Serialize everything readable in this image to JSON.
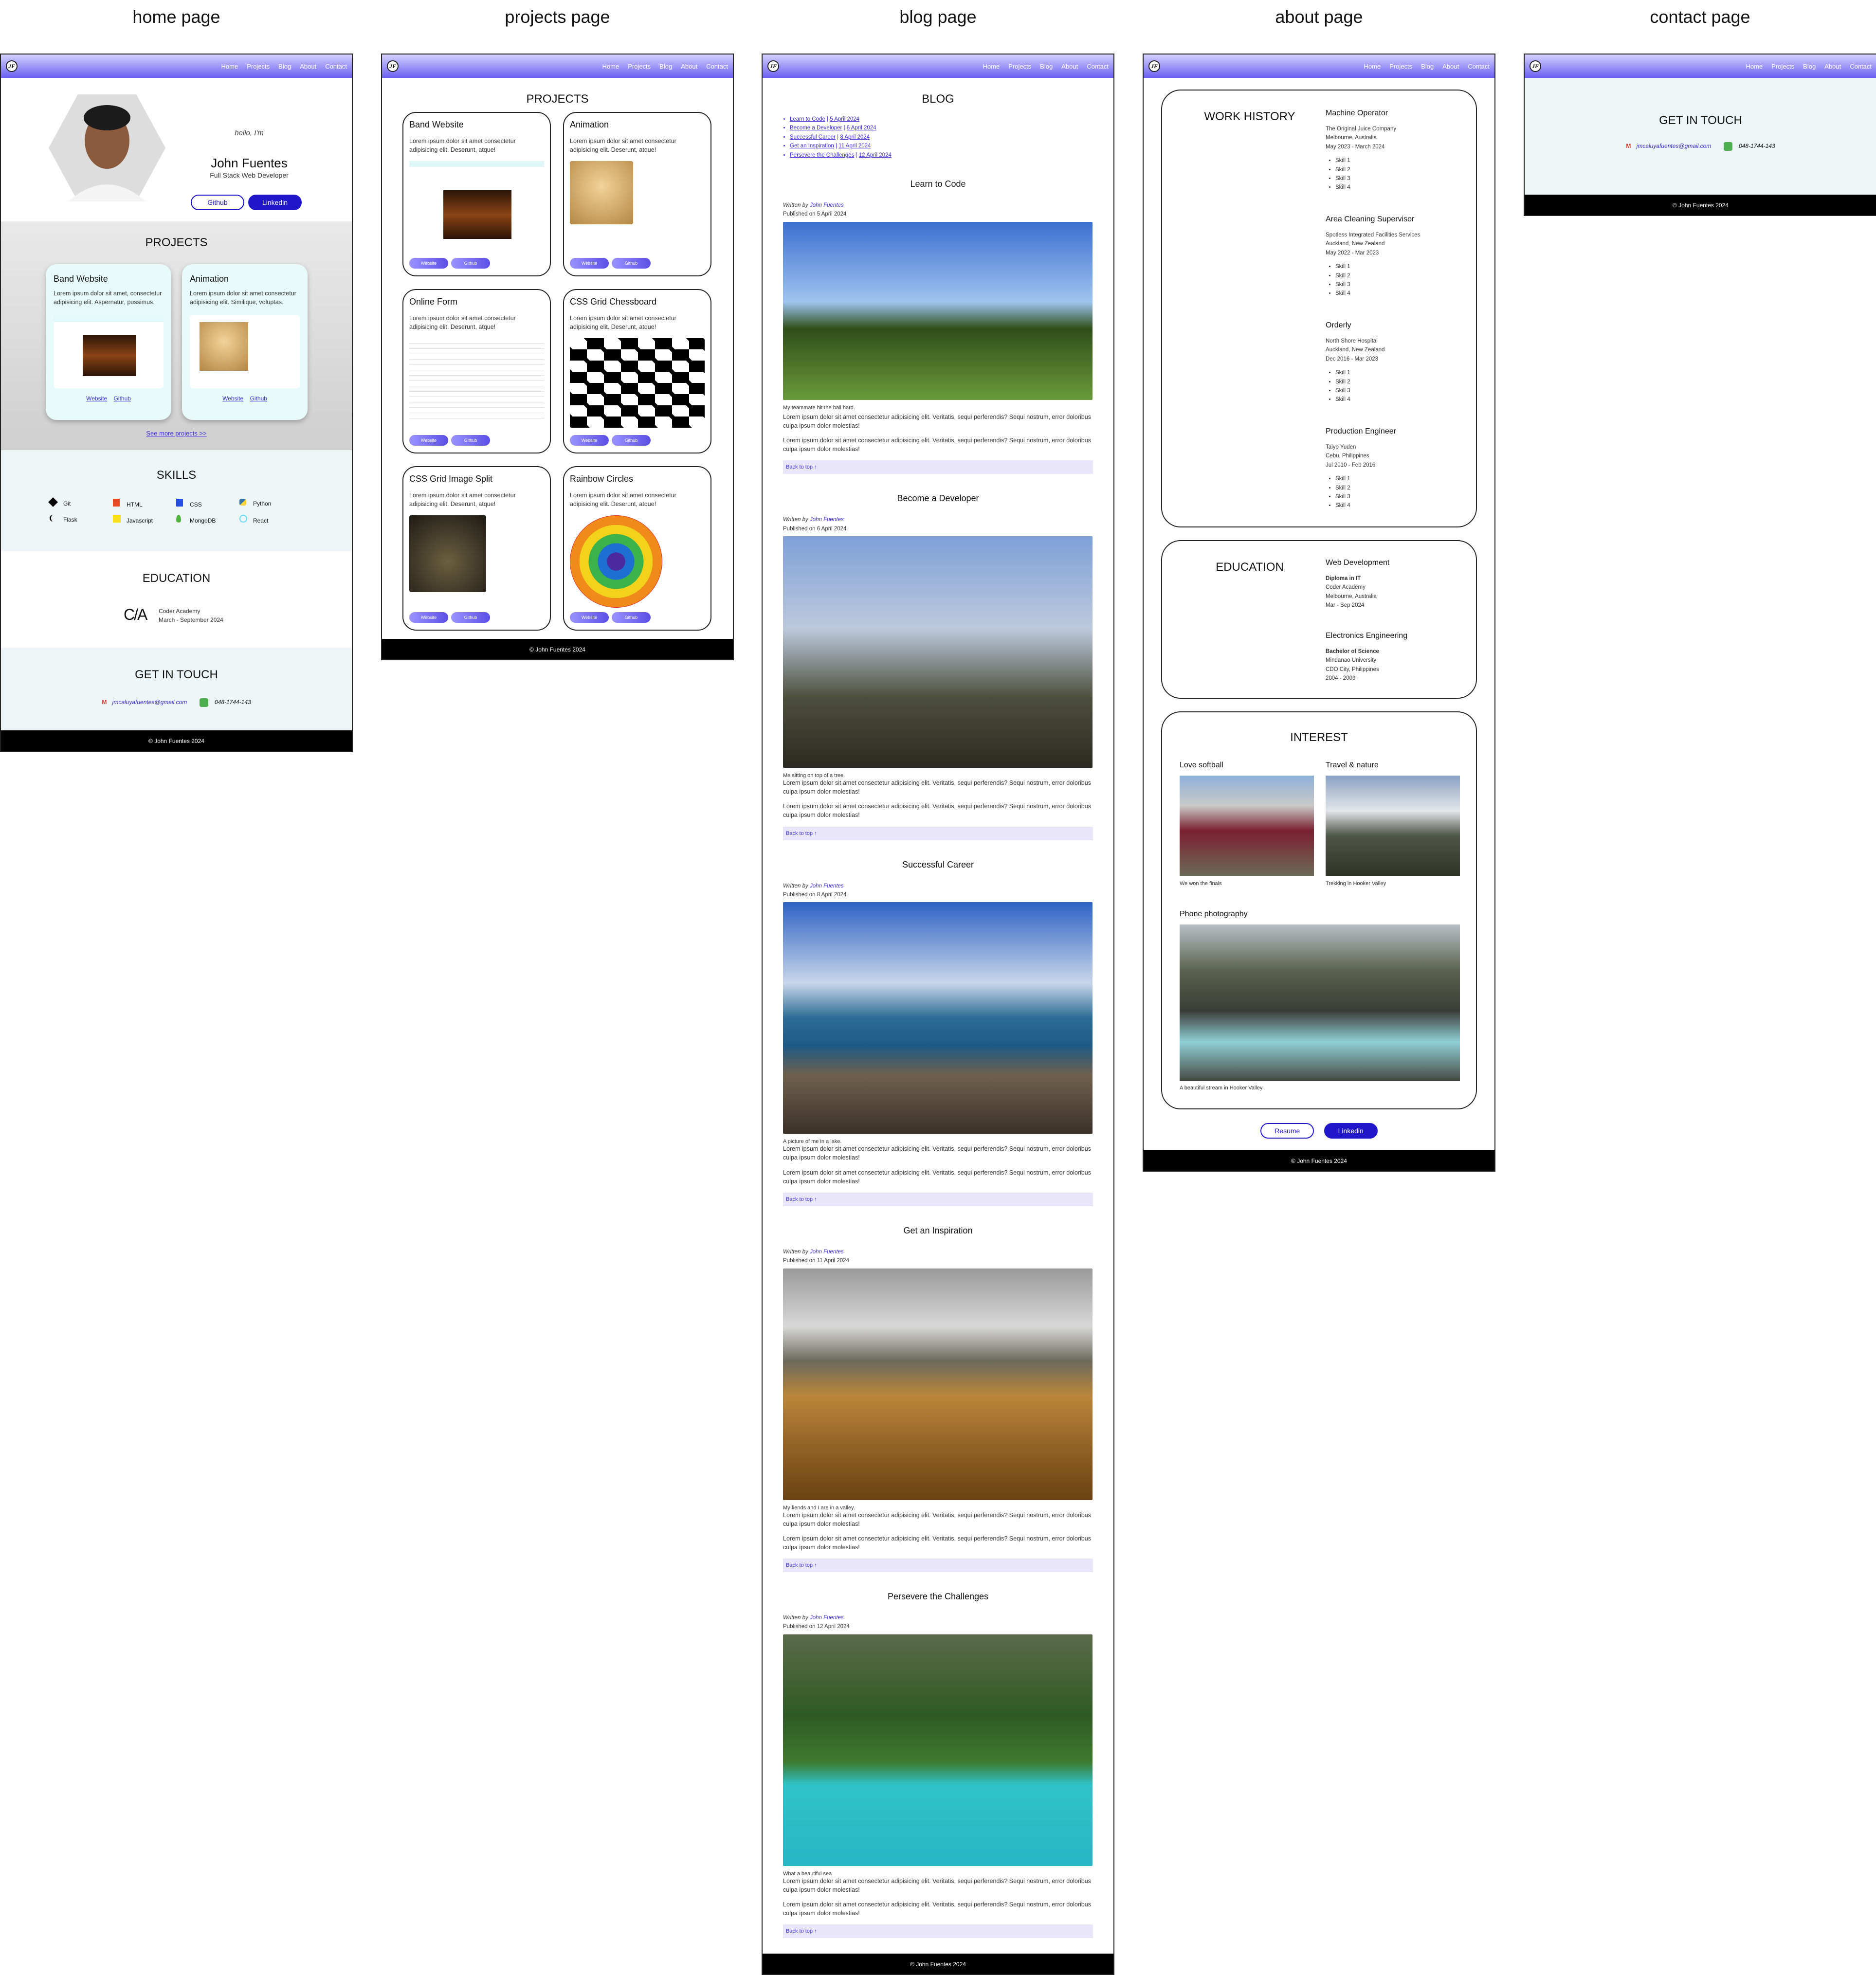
{
  "columns": [
    "home page",
    "projects page",
    "blog page",
    "about page",
    "contact page"
  ],
  "nav": {
    "links": [
      "Home",
      "Projects",
      "Blog",
      "About",
      "Contact"
    ],
    "logo": "JF"
  },
  "footer": "© John Fuentes 2024",
  "home": {
    "greeting": "hello, I'm",
    "name": "John Fuentes",
    "role": "Full Stack Web Developer",
    "github": "Github",
    "linkedin": "Linkedin",
    "projects_title": "PROJECTS",
    "cards": [
      {
        "title": "Band Website",
        "text": "Lorem ipsum dolor sit amet, consectetur adipisicing elit. Aspernatur, possimus.",
        "link1": "Website",
        "link2": "Github"
      },
      {
        "title": "Animation",
        "text": "Lorem ipsum dolor sit amet consectetur adipisicing elit. Similique, voluptas.",
        "link1": "Website",
        "link2": "Github"
      }
    ],
    "see_more": "See more projects >>",
    "skills_title": "SKILLS",
    "skills": [
      "Git",
      "HTML",
      "CSS",
      "Python",
      "Flask",
      "Javascript",
      "MongoDB",
      "React"
    ],
    "education_title": "EDUCATION",
    "edu_school": "Coder Academy",
    "edu_dates": "March - September 2024",
    "contact_title": "GET IN TOUCH",
    "email": "jmcaluyafuentes@gmail.com",
    "phone": "048-1744-143"
  },
  "projects": {
    "title": "PROJECTS",
    "lorem": "Lorem ipsum dolor sit amet consectetur adipisicing elit. Deserunt, atque!",
    "btn1": "Website",
    "btn2": "Github",
    "items": [
      "Band Website",
      "Animation",
      "Online Form",
      "CSS Grid Chessboard",
      "CSS Grid Image Split",
      "Rainbow Circles"
    ]
  },
  "blog": {
    "title": "BLOG",
    "toc": [
      {
        "t": "Learn to Code",
        "d": "5 April 2024"
      },
      {
        "t": "Become a Developer",
        "d": "6 April 2024"
      },
      {
        "t": "Successful Career",
        "d": "8 April 2024"
      },
      {
        "t": "Get an Inspiration",
        "d": "11 April 2024"
      },
      {
        "t": "Persevere the Challenges",
        "d": "12 April 2024"
      }
    ],
    "written_by": "Written by",
    "author": "John Fuentes",
    "lorem": "Lorem ipsum dolor sit amet consectetur adipisicing elit. Veritatis, sequi perferendis? Sequi nostrum, error doloribus culpa ipsum dolor molestias!",
    "back": "Back to top ↑",
    "posts": [
      {
        "title": "Learn to Code",
        "pub": "Published on 5 April 2024",
        "caption": "My teammate hit the ball hard."
      },
      {
        "title": "Become a Developer",
        "pub": "Published on 6 April 2024",
        "caption": "Me sitting on top of a tree."
      },
      {
        "title": "Successful Career",
        "pub": "Published on 8 April 2024",
        "caption": "A picture of me in a lake."
      },
      {
        "title": "Get an Inspiration",
        "pub": "Published on 11 April 2024",
        "caption": "My fiends and I are in a valley."
      },
      {
        "title": "Persevere the Challenges",
        "pub": "Published on 12 April 2024",
        "caption": "What a beautiful sea."
      }
    ]
  },
  "about": {
    "work_title": "WORK HISTORY",
    "jobs": [
      {
        "title": "Machine Operator",
        "l1": "The Original Juice Company",
        "l2": "Melbourne, Australia",
        "l3": "May 2023 - March 2024"
      },
      {
        "title": "Area Cleaning Supervisor",
        "l1": "Spotless Integrated Facilities Services",
        "l2": "Auckland, New Zealand",
        "l3": "May 2022 - Mar 2023"
      },
      {
        "title": "Orderly",
        "l1": "North Shore Hospital",
        "l2": "Auckland, New Zealand",
        "l3": "Dec 2016 - Mar 2023"
      },
      {
        "title": "Production Engineer",
        "l1": "Taiyo Yuden",
        "l2": "Cebu, Philippines",
        "l3": "Jul 2010 - Feb 2016"
      }
    ],
    "skills": [
      "Skill 1",
      "Skill 2",
      "Skill 3",
      "Skill 4"
    ],
    "edu_title": "EDUCATION",
    "edu": [
      {
        "title": "Web Development",
        "l1": "Diploma in IT",
        "l2": "Coder Academy",
        "l3": "Melbourne, Australia",
        "l4": "Mar - Sep 2024"
      },
      {
        "title": "Electronics Engineering",
        "l1": "Bachelor of Science",
        "l2": "Mindanao University",
        "l3": "CDO City, Philippines",
        "l4": "2004 - 2009"
      }
    ],
    "interest_title": "INTEREST",
    "i1": "Love softball",
    "i1c": "We won the finals",
    "i2": "Travel & nature",
    "i2c": "Trekking in Hooker Valley",
    "i3": "Phone photography",
    "i3c": "A beautiful stream in Hooker Valley",
    "resume": "Resume",
    "linkedin": "Linkedin"
  },
  "contact": {
    "title": "GET IN TOUCH",
    "email": "jmcaluyafuentes@gmail.com",
    "phone": "048-1744-143"
  }
}
